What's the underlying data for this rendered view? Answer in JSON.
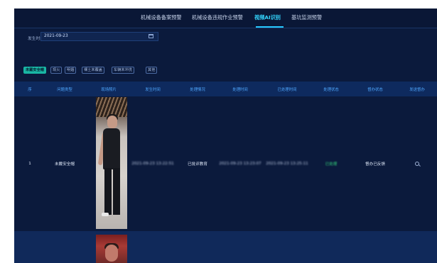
{
  "nav": {
    "items": [
      {
        "label": "机械设备备案预警",
        "active": false
      },
      {
        "label": "机械设备违规作业预警",
        "active": false
      },
      {
        "label": "视频AI识别",
        "active": true
      },
      {
        "label": "基坑监测预警",
        "active": false
      }
    ]
  },
  "filter": {
    "label": "发生时间:",
    "date_value": "2021-09-23",
    "date_icon": "calendar-icon"
  },
  "chips": [
    {
      "label": "未戴安全帽",
      "active": true
    },
    {
      "label": "现火",
      "active": false
    },
    {
      "label": "明烟",
      "active": false
    },
    {
      "label": "裸土未覆盖",
      "active": false
    },
    {
      "label": "车辆未冲洗",
      "active": false
    },
    {
      "label": "其他",
      "active": false
    }
  ],
  "table": {
    "headers": [
      "序",
      "问题类型",
      "现场照片",
      "发生时间",
      "处理情况",
      "处理时间",
      "已处理时间",
      "处理状态",
      "督办状态",
      "发送督办"
    ],
    "rows": [
      {
        "index": "1",
        "type": "未戴安全帽",
        "occurred": "2021-09-23 13:22:51",
        "handling": "已批评教育",
        "handled_time": "2021-09-23 13:23:07",
        "processed_time": "2021-09-23 13:25:11",
        "status": "已处理",
        "supervise": "督办已反馈",
        "action_icon": "search-icon"
      },
      {
        "index": "",
        "type": "",
        "occurred": "",
        "handling": "",
        "handled_time": "",
        "processed_time": "",
        "status": "",
        "supervise": "",
        "action_icon": ""
      }
    ]
  },
  "colors": {
    "background": "#0b1a3c",
    "accent": "#33d6ff",
    "chip_active": "#19b6a4",
    "status_green": "#33d17a",
    "header_text": "#4fa8ff"
  }
}
